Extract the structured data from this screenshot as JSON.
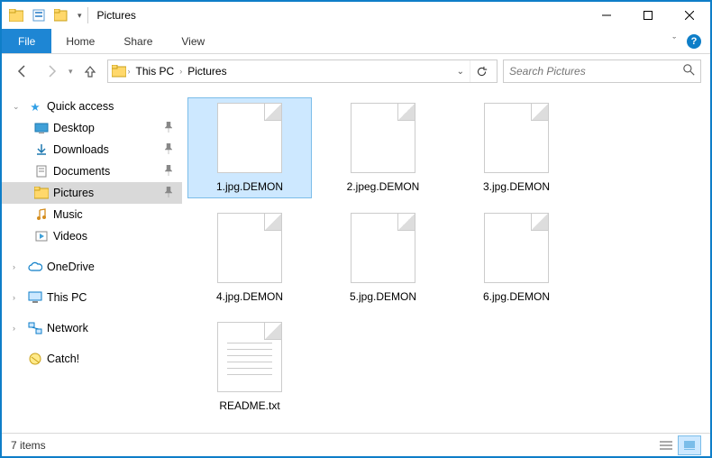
{
  "title": "Pictures",
  "ribbon": {
    "file": "File",
    "tabs": [
      "Home",
      "Share",
      "View"
    ]
  },
  "address": {
    "crumbs": [
      "This PC",
      "Pictures"
    ]
  },
  "search": {
    "placeholder": "Search Pictures"
  },
  "sidebar": {
    "quick_access": "Quick access",
    "items": [
      {
        "label": "Desktop",
        "pinned": true
      },
      {
        "label": "Downloads",
        "pinned": true
      },
      {
        "label": "Documents",
        "pinned": true
      },
      {
        "label": "Pictures",
        "pinned": true,
        "selected": true
      },
      {
        "label": "Music",
        "pinned": false
      },
      {
        "label": "Videos",
        "pinned": false
      }
    ],
    "onedrive": "OneDrive",
    "this_pc": "This PC",
    "network": "Network",
    "catch": "Catch!"
  },
  "files": [
    {
      "name": "1.jpg.DEMON",
      "type": "blank",
      "selected": true
    },
    {
      "name": "2.jpeg.DEMON",
      "type": "blank"
    },
    {
      "name": "3.jpg.DEMON",
      "type": "blank"
    },
    {
      "name": "4.jpg.DEMON",
      "type": "blank"
    },
    {
      "name": "5.jpg.DEMON",
      "type": "blank"
    },
    {
      "name": "6.jpg.DEMON",
      "type": "blank"
    },
    {
      "name": "README.txt",
      "type": "text"
    }
  ],
  "status": {
    "count_label": "7 items"
  }
}
